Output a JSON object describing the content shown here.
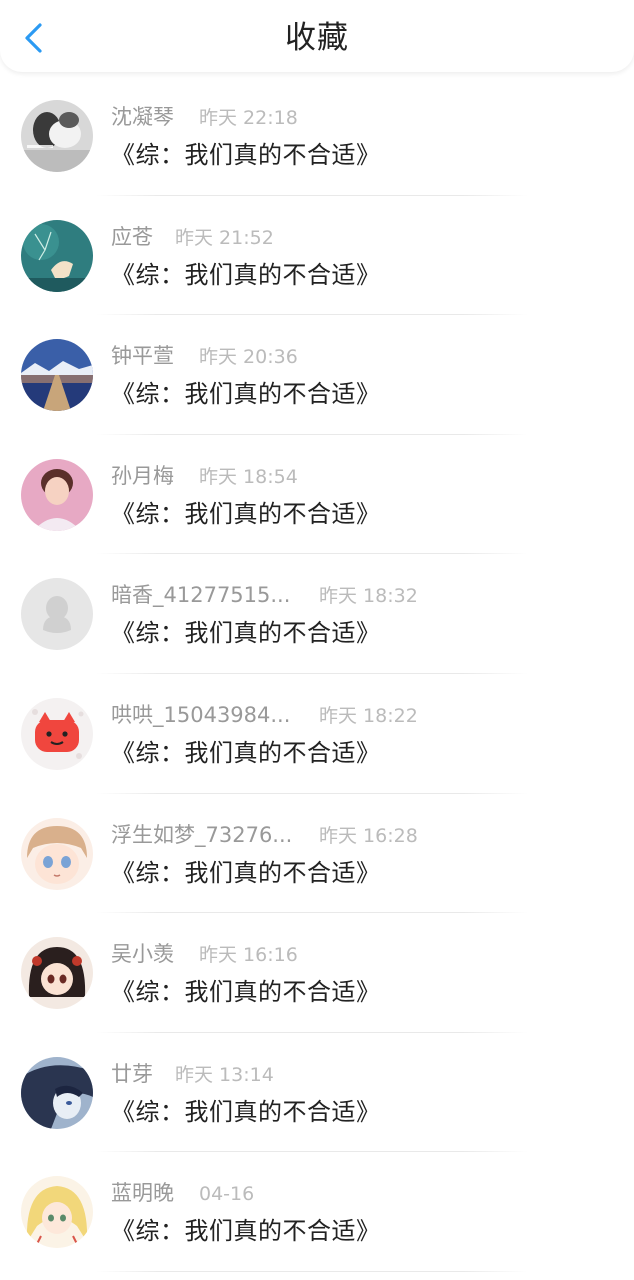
{
  "header": {
    "title": "收藏",
    "back_icon": "chevron-left-icon",
    "accent_color": "#2b9af3"
  },
  "items": [
    {
      "name": "沈凝琴",
      "time": "昨天 22:18",
      "message": "《综：我们真的不合适》",
      "avatar": "photo-avatar"
    },
    {
      "name": "应苍",
      "time": "昨天 21:52",
      "message": "《综：我们真的不合适》",
      "avatar": "teal-deer-avatar"
    },
    {
      "name": "钟平萱",
      "time": "昨天 20:36",
      "message": "《综：我们真的不合适》",
      "avatar": "lake-pier-avatar"
    },
    {
      "name": "孙月梅",
      "time": "昨天 18:54",
      "message": "《综：我们真的不合适》",
      "avatar": "portrait-avatar"
    },
    {
      "name": "暗香_41277515...",
      "time": "昨天 18:32",
      "message": "《综：我们真的不合适》",
      "avatar": "default-penguin-avatar"
    },
    {
      "name": "哄哄_15043984...",
      "time": "昨天 18:22",
      "message": "《综：我们真的不合适》",
      "avatar": "red-pig-avatar"
    },
    {
      "name": "浮生如梦_73276...",
      "time": "昨天 16:28",
      "message": "《综：我们真的不合适》",
      "avatar": "anime-girl-avatar"
    },
    {
      "name": "吴小羡",
      "time": "昨天 16:16",
      "message": "《综：我们真的不合适》",
      "avatar": "anime-chibi-avatar"
    },
    {
      "name": "廿芽",
      "time": "昨天 13:14",
      "message": "《综：我们真的不合适》",
      "avatar": "anime-dark-avatar"
    },
    {
      "name": "蓝明晚",
      "time": "04-16",
      "message": "《综：我们真的不合适》",
      "avatar": "anime-blonde-avatar"
    }
  ]
}
